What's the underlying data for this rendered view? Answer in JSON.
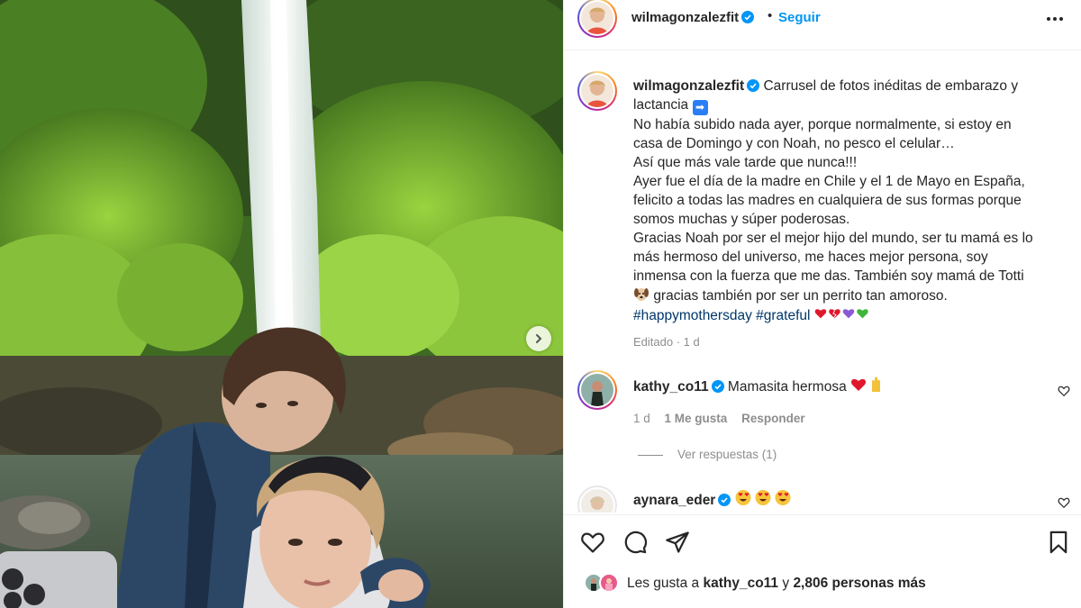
{
  "header": {
    "username": "wilmagonzalezfit",
    "separator": "•",
    "follow_label": "Seguir",
    "more_label": "···"
  },
  "caption": {
    "username": "wilmagonzalezfit",
    "lines": [
      "Carrusel de fotos inéditas de embarazo y lactancia",
      "No había subido nada ayer, porque normalmente, si estoy en casa de Domingo y con Noah, no pesco el celular…",
      "Así que más vale tarde que nunca!!!",
      "Ayer fue el día de la madre en Chile y el 1 de Mayo en España, felicito a todas las madres en cualquiera de sus formas porque somos muchas y súper poderosas.",
      "Gracias Noah por ser el mejor hijo del mundo, ser tu mamá es lo más hermoso del universo, me haces mejor persona, soy inmensa con la fuerza que me das. También soy mamá de Totti",
      "gracias también por ser un perrito tan amoroso."
    ],
    "hashtags": [
      "#happymothersday",
      "#grateful"
    ],
    "edited": "Editado · 1 d"
  },
  "comments": [
    {
      "username": "kathy_co11",
      "text": "Mamasita hermosa",
      "time": "1 d",
      "likes": "1 Me gusta",
      "reply_label": "Responder",
      "view_replies": "Ver respuestas (1)"
    },
    {
      "username": "aynara_eder",
      "text": ""
    }
  ],
  "likes": {
    "prefix": "Les gusta a",
    "user": "kathy_co11",
    "conj": "y",
    "others": "2,806 personas más"
  },
  "colors": {
    "link_blue": "#0095f6",
    "hashtag": "#00376b",
    "verified": "#0095f6",
    "muted": "#8e8e8e"
  },
  "icons": [
    "verified-icon",
    "more-icon",
    "next-arrow-icon",
    "heart-icon",
    "comment-icon",
    "share-icon",
    "bookmark-icon"
  ]
}
